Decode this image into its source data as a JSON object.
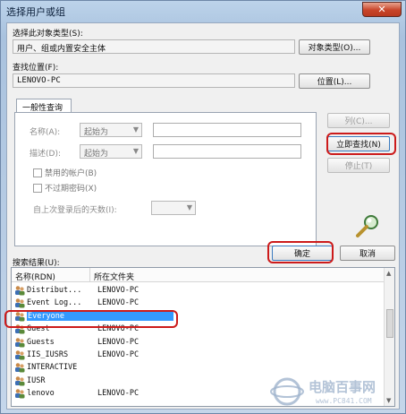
{
  "window": {
    "title": "选择用户或组",
    "close_glyph": "✕"
  },
  "object_type": {
    "label": "选择此对象类型(S):",
    "value": "用户、组或内置安全主体",
    "button": "对象类型(O)..."
  },
  "location": {
    "label": "查找位置(F):",
    "value": "LENOVO-PC",
    "button": "位置(L)..."
  },
  "query": {
    "tab": "一般性查询",
    "name_label": "名称(A):",
    "name_mode": "起始为",
    "desc_label": "描述(D):",
    "desc_mode": "起始为",
    "disabled_accounts": "禁用的帐户(B)",
    "non_expiring_pw": "不过期密码(X)",
    "days_since_login": "自上次登录后的天数(I):",
    "columns_button": "列(C)...",
    "find_now_button": "立即查找(N)",
    "stop_button": "停止(T)"
  },
  "results": {
    "label": "搜索结果(U):",
    "ok_button": "确定",
    "cancel_button": "取消",
    "columns": [
      "名称(RDN)",
      "所在文件夹"
    ],
    "rows": [
      {
        "name": "Distribut...",
        "folder": "LENOVO-PC"
      },
      {
        "name": "Event Log...",
        "folder": "LENOVO-PC"
      },
      {
        "name": "Everyone",
        "folder": ""
      },
      {
        "name": "Guest",
        "folder": "LENOVO-PC"
      },
      {
        "name": "Guests",
        "folder": "LENOVO-PC"
      },
      {
        "name": "IIS_IUSRS",
        "folder": "LENOVO-PC"
      },
      {
        "name": "INTERACTIVE",
        "folder": ""
      },
      {
        "name": "IUSR",
        "folder": ""
      },
      {
        "name": "lenovo",
        "folder": "LENOVO-PC"
      }
    ],
    "selected_index": 2
  },
  "watermark": {
    "text": "电脑百事网",
    "sub": "www.PC841.COM"
  },
  "colors": {
    "selection": "#3399ff",
    "annotation": "#cc1b1b"
  }
}
